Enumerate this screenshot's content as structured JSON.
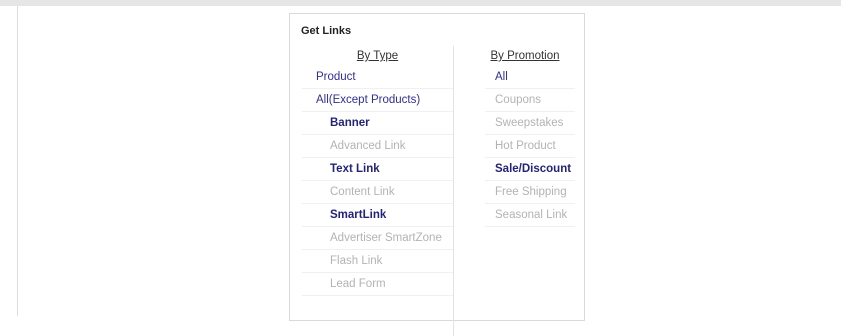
{
  "panel": {
    "title": "Get Links"
  },
  "by_type": {
    "header": "By Type",
    "items": [
      {
        "label": "Product",
        "enabled": true,
        "indent": false
      },
      {
        "label": "All(Except Products)",
        "enabled": true,
        "indent": false
      },
      {
        "label": "Banner",
        "enabled": true,
        "indent": true
      },
      {
        "label": "Advanced Link",
        "enabled": false,
        "indent": true
      },
      {
        "label": "Text Link",
        "enabled": true,
        "indent": true
      },
      {
        "label": "Content Link",
        "enabled": false,
        "indent": true
      },
      {
        "label": "SmartLink",
        "enabled": true,
        "indent": true
      },
      {
        "label": "Advertiser SmartZone",
        "enabled": false,
        "indent": true
      },
      {
        "label": "Flash Link",
        "enabled": false,
        "indent": true
      },
      {
        "label": "Lead Form",
        "enabled": false,
        "indent": true
      }
    ]
  },
  "by_promotion": {
    "header": "By Promotion",
    "items": [
      {
        "label": "All",
        "enabled": true
      },
      {
        "label": "Coupons",
        "enabled": false
      },
      {
        "label": "Sweepstakes",
        "enabled": false
      },
      {
        "label": "Hot Product",
        "enabled": false
      },
      {
        "label": "Sale/Discount",
        "enabled": true
      },
      {
        "label": "Free Shipping",
        "enabled": false
      },
      {
        "label": "Seasonal Link",
        "enabled": false
      }
    ]
  },
  "colors": {
    "link": "#2f2f9a",
    "disabled": "#b3b3b3",
    "border": "#d9d9d9"
  }
}
